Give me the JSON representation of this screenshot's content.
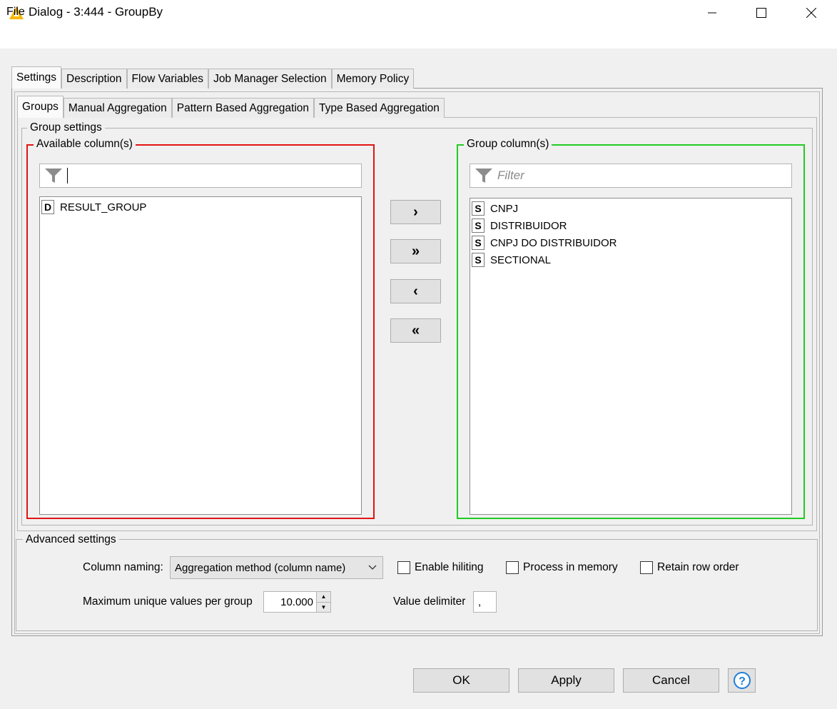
{
  "window": {
    "title": "Dialog - 3:444 - GroupBy",
    "icon": "knime-triangle-icon"
  },
  "menu": {
    "file": "File"
  },
  "outer_tabs": [
    {
      "label": "Settings",
      "active": true
    },
    {
      "label": "Description"
    },
    {
      "label": "Flow Variables"
    },
    {
      "label": "Job Manager Selection"
    },
    {
      "label": "Memory Policy"
    }
  ],
  "inner_tabs": [
    {
      "label": "Groups",
      "active": true
    },
    {
      "label": "Manual Aggregation"
    },
    {
      "label": "Pattern Based Aggregation"
    },
    {
      "label": "Type Based Aggregation"
    }
  ],
  "group_settings": {
    "title": "Group settings",
    "available": {
      "title": "Available column(s)",
      "filter_value": "",
      "border_color": "#e11414",
      "items": [
        {
          "type": "D",
          "name": "RESULT_GROUP"
        }
      ]
    },
    "grouped": {
      "title": "Group column(s)",
      "filter_placeholder": "Filter",
      "border_color": "#22cc22",
      "items": [
        {
          "type": "S",
          "name": "CNPJ"
        },
        {
          "type": "S",
          "name": "DISTRIBUIDOR"
        },
        {
          "type": "S",
          "name": "CNPJ DO DISTRIBUIDOR"
        },
        {
          "type": "S",
          "name": "SECTIONAL"
        }
      ]
    },
    "move_buttons": {
      "add": "›",
      "add_all": "»",
      "remove": "‹",
      "remove_all": "«"
    }
  },
  "advanced": {
    "title": "Advanced settings",
    "column_naming_label": "Column naming:",
    "column_naming_value": "Aggregation method (column name)",
    "enable_hiliting": {
      "label": "Enable hiliting",
      "checked": false
    },
    "process_in_memory": {
      "label": "Process in memory",
      "checked": false
    },
    "retain_row_order": {
      "label": "Retain row order",
      "checked": false
    },
    "max_unique_label": "Maximum unique values per group",
    "max_unique_value": "10.000",
    "value_delimiter_label": "Value delimiter",
    "value_delimiter_value": ","
  },
  "buttons": {
    "ok": "OK",
    "apply": "Apply",
    "cancel": "Cancel",
    "help": "?"
  },
  "colors": {
    "help_accent": "#1e7fd8",
    "icon_yellow": "#f5b800"
  }
}
